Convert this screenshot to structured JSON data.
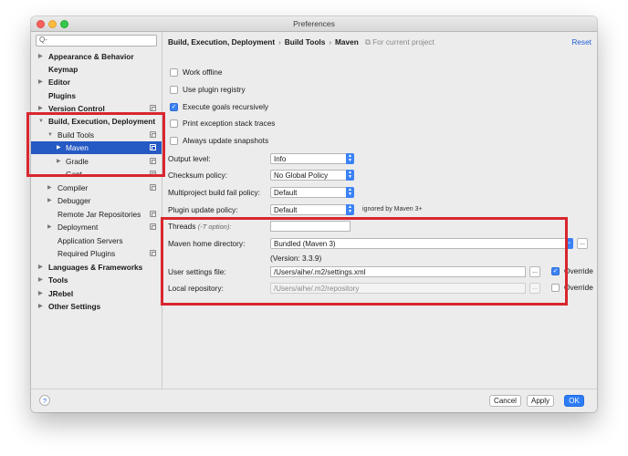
{
  "window": {
    "title": "Preferences"
  },
  "sidebar": {
    "search_placeholder": "Q-",
    "items": [
      {
        "label": "Appearance & Behavior",
        "arrow": "▶",
        "bold": true
      },
      {
        "label": "Keymap",
        "bold": true
      },
      {
        "label": "Editor",
        "arrow": "▶",
        "bold": true
      },
      {
        "label": "Plugins",
        "bold": true
      },
      {
        "label": "Version Control",
        "arrow": "▶",
        "bold": true
      },
      {
        "label": "Build, Execution, Deployment",
        "arrow": "▼",
        "bold": true
      },
      {
        "label": "Build Tools",
        "arrow": "▼"
      },
      {
        "label": "Maven",
        "arrow": "▶",
        "selected": true
      },
      {
        "label": "Gradle",
        "arrow": "▶"
      },
      {
        "label": "Gant"
      },
      {
        "label": "Compiler",
        "arrow": "▶"
      },
      {
        "label": "Debugger",
        "arrow": "▶"
      },
      {
        "label": "Remote Jar Repositories"
      },
      {
        "label": "Deployment",
        "arrow": "▶"
      },
      {
        "label": "Application Servers"
      },
      {
        "label": "Required Plugins"
      },
      {
        "label": "Languages & Frameworks",
        "arrow": "▶",
        "bold": true
      },
      {
        "label": "Tools",
        "arrow": "▶",
        "bold": true
      },
      {
        "label": "JRebel",
        "arrow": "▶",
        "bold": true
      },
      {
        "label": "Other Settings",
        "arrow": "▶",
        "bold": true
      }
    ]
  },
  "breadcrumb": {
    "part1": "Build, Execution, Deployment",
    "part2": "Build Tools",
    "part3": "Maven",
    "separator": "›",
    "note": "For current project",
    "reset": "Reset"
  },
  "checkboxes": [
    {
      "label": "Work offline",
      "checked": false
    },
    {
      "label": "Use plugin registry",
      "checked": false
    },
    {
      "label": "Execute goals recursively",
      "checked": true
    },
    {
      "label": "Print exception stack traces",
      "checked": false
    },
    {
      "label": "Always update snapshots",
      "checked": false
    }
  ],
  "settings": {
    "output_level": {
      "label": "Output level:",
      "value": "Info"
    },
    "checksum_policy": {
      "label": "Checksum policy:",
      "value": "No Global Policy"
    },
    "multiproject_fail": {
      "label": "Multiproject build fail policy:",
      "value": "Default"
    },
    "plugin_update": {
      "label": "Plugin update policy:",
      "value": "Default",
      "hint": "ignored by Maven 3+"
    },
    "threads": {
      "label": "Threads",
      "option": "(-T option):",
      "value": ""
    },
    "maven_home": {
      "label": "Maven home directory:",
      "value": "Bundled (Maven 3)",
      "version": "(Version: 3.3.9)"
    },
    "user_settings": {
      "label": "User settings file:",
      "value": "/Users/aihe/.m2/settings.xml",
      "override_label": "Override",
      "override_checked": true
    },
    "local_repo": {
      "label": "Local repository:",
      "value": "/Users/aihe/.m2/repository",
      "override_label": "Override",
      "override_checked": false
    },
    "browse_label": "..."
  },
  "footer": {
    "help": "?",
    "cancel": "Cancel",
    "apply": "Apply",
    "ok": "OK"
  },
  "colors": {
    "selection": "#2559c4",
    "accent": "#3b82f6",
    "annotation": "#d9262f"
  }
}
